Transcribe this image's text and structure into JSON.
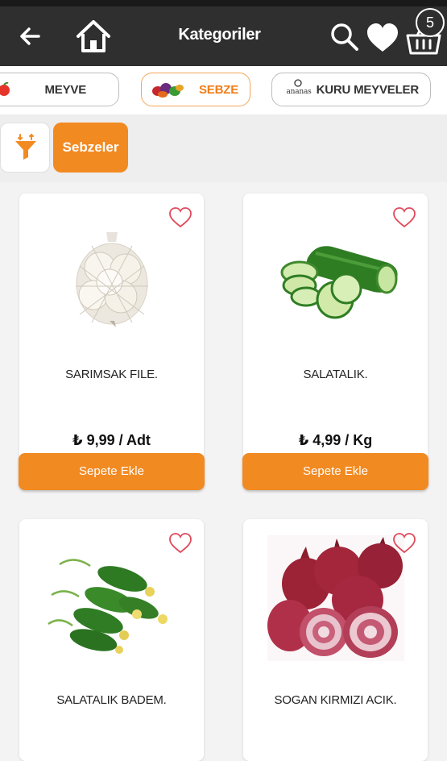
{
  "appbar": {
    "title": "Kategoriler",
    "cart_count": "5"
  },
  "categories": [
    {
      "label": "MEYVE"
    },
    {
      "label": "SEBZE",
      "active": true
    },
    {
      "label": "KURU MEYVELER",
      "logo_text": "ananas"
    }
  ],
  "subcategory": {
    "label": "Sebzeler"
  },
  "products": [
    {
      "name": "SARIMSAK FILE.",
      "price": "₺ 9,99 / Adt",
      "button": "Sepete Ekle",
      "icon": "garlic-image"
    },
    {
      "name": "SALATALIK.",
      "price": "₺ 4,99 / Kg",
      "button": "Sepete Ekle",
      "icon": "cucumber-image"
    },
    {
      "name": "SALATALIK BADEM.",
      "icon": "baby-cucumber-image"
    },
    {
      "name": "SOGAN KIRMIZI ACIK.",
      "icon": "red-onion-image"
    }
  ],
  "colors": {
    "accent": "#f28a22",
    "appbar": "#2f2f2f",
    "heart": "#e04a5b"
  }
}
